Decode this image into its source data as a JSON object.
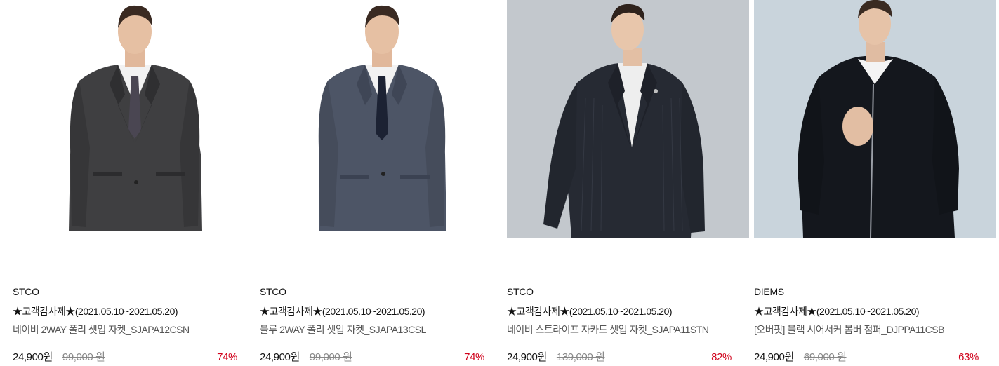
{
  "products": [
    {
      "brand": "STCO",
      "promo": "★고객감사제★(2021.05.10~2021.05.20)",
      "name": "네이비 2WAY 폴리 셋업 자켓_SJAPA12CSN",
      "price": "24,900원",
      "original_price": "99,000 원",
      "discount": "74%",
      "image": {
        "bg": "#ffffff",
        "jacket": "#3f3f41",
        "shirt": "#f2f2f2",
        "tie": "#4a4652",
        "kind": "suit"
      }
    },
    {
      "brand": "STCO",
      "promo": "★고객감사제★(2021.05.10~2021.05.20)",
      "name": "블루 2WAY 폴리 셋업 자켓_SJAPA13CSL",
      "price": "24,900원",
      "original_price": "99,000 원",
      "discount": "74%",
      "image": {
        "bg": "#ffffff",
        "jacket": "#4d5566",
        "shirt": "#f2f2f2",
        "tie": "#1c2233",
        "kind": "suit"
      }
    },
    {
      "brand": "STCO",
      "promo": "★고객감사제★(2021.05.10~2021.05.20)",
      "name": "네이비 스트라이프 자카드 셋업 자켓_SJAPA11STN",
      "price": "24,900원",
      "original_price": "139,000 원",
      "discount": "82%",
      "image": {
        "bg": "#c3c8cd",
        "jacket": "#262a33",
        "shirt": "#eeeeee",
        "tie": "",
        "kind": "suit-open"
      }
    },
    {
      "brand": "DIEMS",
      "promo": "★고객감사제★(2021.05.10~2021.05.20)",
      "name": "[오버핏] 블랙 시어서커 봄버 점퍼_DJPPA11CSB",
      "price": "24,900원",
      "original_price": "69,000 원",
      "discount": "63%",
      "image": {
        "bg": "#c9d4dc",
        "jacket": "#14171d",
        "shirt": "#f4f4f4",
        "tie": "",
        "kind": "bomber"
      }
    }
  ]
}
